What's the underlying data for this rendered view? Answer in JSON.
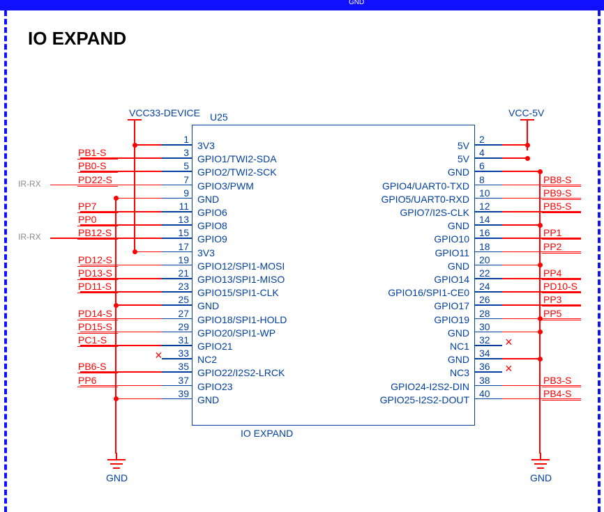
{
  "title": "IO EXPAND",
  "topcrop": "GND",
  "refdes": "U25",
  "blocklabel": "IO EXPAND",
  "power_left": "VCC33-DEVICE",
  "power_right": "VCC-5V",
  "gndL": "GND",
  "gndR": "GND",
  "left_pins": [
    {
      "n": "1",
      "f": "3V3",
      "net": "",
      "port": ""
    },
    {
      "n": "3",
      "f": "GPIO1/TWI2-SDA",
      "net": "PB1-S",
      "port": ""
    },
    {
      "n": "5",
      "f": "GPIO2/TWI2-SCK",
      "net": "PB0-S",
      "port": ""
    },
    {
      "n": "7",
      "f": "GPIO3/PWM",
      "net": "PD22-S",
      "port": "IR-RX"
    },
    {
      "n": "9",
      "f": "GND",
      "net": "",
      "port": ""
    },
    {
      "n": "11",
      "f": "GPIO6",
      "net": "PP7",
      "port": ""
    },
    {
      "n": "13",
      "f": "GPIO8",
      "net": "PP0",
      "port": ""
    },
    {
      "n": "15",
      "f": "GPIO9",
      "net": "PB12-S",
      "port": "IR-RX"
    },
    {
      "n": "17",
      "f": "3V3",
      "net": "",
      "port": ""
    },
    {
      "n": "19",
      "f": "GPIO12/SPI1-MOSI",
      "net": "PD12-S",
      "port": ""
    },
    {
      "n": "21",
      "f": "GPIO13/SPI1-MISO",
      "net": "PD13-S",
      "port": ""
    },
    {
      "n": "23",
      "f": "GPIO15/SPI1-CLK",
      "net": "PD11-S",
      "port": ""
    },
    {
      "n": "25",
      "f": "GND",
      "net": "",
      "port": ""
    },
    {
      "n": "27",
      "f": "GPIO18/SPI1-HOLD",
      "net": "PD14-S",
      "port": ""
    },
    {
      "n": "29",
      "f": "GPIO20/SPI1-WP",
      "net": "PD15-S",
      "port": ""
    },
    {
      "n": "31",
      "f": "GPIO21",
      "net": "PC1-S",
      "port": ""
    },
    {
      "n": "33",
      "f": "NC2",
      "net": "",
      "port": "",
      "nc": true
    },
    {
      "n": "35",
      "f": "GPIO22/I2S2-LRCK",
      "net": "PB6-S",
      "port": ""
    },
    {
      "n": "37",
      "f": "GPIO23",
      "net": "PP6",
      "port": ""
    },
    {
      "n": "39",
      "f": "GND",
      "net": "",
      "port": ""
    }
  ],
  "right_pins": [
    {
      "n": "2",
      "f": "5V",
      "net": "",
      "port": ""
    },
    {
      "n": "4",
      "f": "5V",
      "net": "",
      "port": ""
    },
    {
      "n": "6",
      "f": "GND",
      "net": "",
      "port": ""
    },
    {
      "n": "8",
      "f": "GPIO4/UART0-TXD",
      "net": "PB8-S",
      "port": ""
    },
    {
      "n": "10",
      "f": "GPIO5/UART0-RXD",
      "net": "PB9-S",
      "port": ""
    },
    {
      "n": "12",
      "f": "GPIO7/I2S-CLK",
      "net": "PB5-S",
      "port": ""
    },
    {
      "n": "14",
      "f": "GND",
      "net": "",
      "port": ""
    },
    {
      "n": "16",
      "f": "GPIO10",
      "net": "PP1",
      "port": ""
    },
    {
      "n": "18",
      "f": "GPIO11",
      "net": "PP2",
      "port": ""
    },
    {
      "n": "20",
      "f": "GND",
      "net": "",
      "port": ""
    },
    {
      "n": "22",
      "f": "GPIO14",
      "net": "PP4",
      "port": ""
    },
    {
      "n": "24",
      "f": "GPIO16/SPI1-CE0",
      "net": "PD10-S",
      "port": ""
    },
    {
      "n": "26",
      "f": "GPIO17",
      "net": "PP3",
      "port": ""
    },
    {
      "n": "28",
      "f": "GPIO19",
      "net": "PP5",
      "port": ""
    },
    {
      "n": "30",
      "f": "GND",
      "net": "",
      "port": ""
    },
    {
      "n": "32",
      "f": "NC1",
      "net": "",
      "port": "",
      "nc": true
    },
    {
      "n": "34",
      "f": "GND",
      "net": "",
      "port": ""
    },
    {
      "n": "36",
      "f": "NC3",
      "net": "",
      "port": "",
      "nc": true
    },
    {
      "n": "38",
      "f": "GPIO24-I2S2-DIN",
      "net": "PB3-S",
      "port": ""
    },
    {
      "n": "40",
      "f": "GPIO25-I2S2-DOUT",
      "net": "PB4-S",
      "port": ""
    }
  ]
}
